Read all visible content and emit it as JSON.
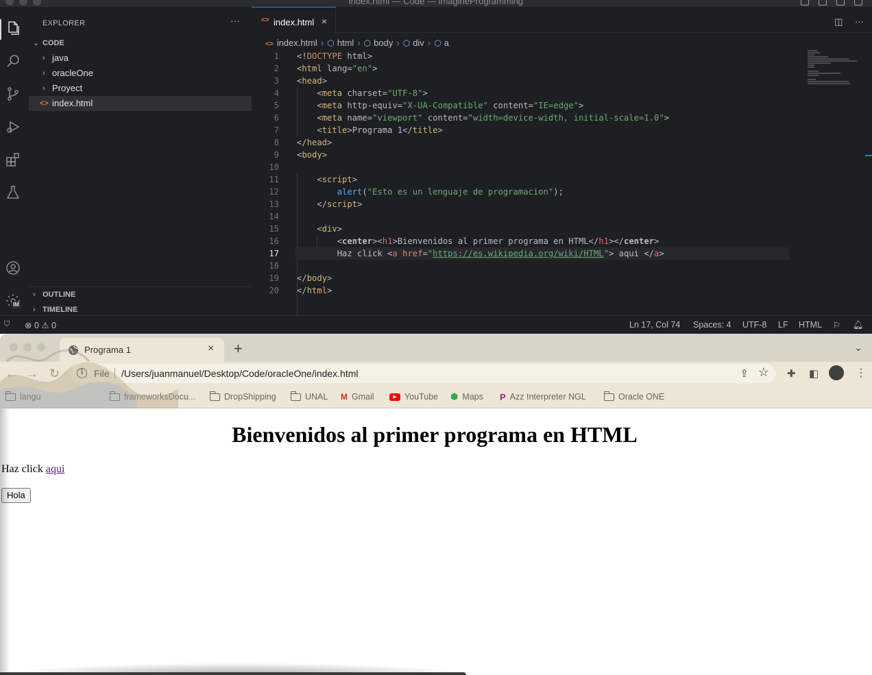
{
  "vscode": {
    "window_title": "index.html — Code — imagineProgramming",
    "explorer": {
      "header": "EXPLORER",
      "more": "···",
      "root_folder": "CODE",
      "items": [
        {
          "label": "java",
          "type": "folder"
        },
        {
          "label": "oracleOne",
          "type": "folder"
        },
        {
          "label": "Proyect",
          "type": "folder"
        },
        {
          "label": "index.html",
          "type": "file",
          "selected": true
        }
      ],
      "outline": "OUTLINE",
      "timeline": "TIMELINE"
    },
    "account_badge": "IM",
    "tab": {
      "label": "index.html",
      "close": "×"
    },
    "breadcrumbs": [
      "index.html",
      "html",
      "body",
      "div",
      "a"
    ],
    "code_lines": [
      "1",
      "2",
      "3",
      "4",
      "5",
      "6",
      "7",
      "8",
      "9",
      "10",
      "11",
      "12",
      "13",
      "14",
      "15",
      "16",
      "17",
      "18",
      "19",
      "20"
    ],
    "code": {
      "l1": [
        "<!",
        "DOCTYPE",
        " html",
        ">"
      ],
      "l2": [
        "<",
        "html",
        " lang",
        "=",
        "\"en\"",
        ">"
      ],
      "l3": [
        "<",
        "head",
        ">"
      ],
      "l4": [
        "<",
        "meta",
        " charset",
        "=",
        "\"UTF-8\"",
        ">"
      ],
      "l5": [
        "<",
        "meta",
        " http-equiv",
        "=",
        "\"X-UA-Compatible\"",
        " content",
        "=",
        "\"IE=edge\"",
        ">"
      ],
      "l6": [
        "<",
        "meta",
        " name",
        "=",
        "\"viewport\"",
        " content",
        "=",
        "\"width=device-width, initial-scale=1.0\"",
        ">"
      ],
      "l7": [
        "<",
        "title",
        ">",
        "Programa 1",
        "</",
        "title",
        ">"
      ],
      "l8": [
        "</",
        "head",
        ">"
      ],
      "l9": [
        "<",
        "body",
        ">"
      ],
      "l11": [
        "<",
        "script",
        ">"
      ],
      "l12": [
        "alert",
        "(",
        "\"Esto es un lenguaje de programacion\"",
        ");"
      ],
      "l13": [
        "</",
        "script",
        ">"
      ],
      "l15": [
        "<",
        "div",
        ">"
      ],
      "l16": [
        "<",
        "center",
        "><",
        "h1",
        ">",
        "Bienvenidos al primer programa en HTML",
        "</",
        "h1",
        "></",
        "center",
        ">"
      ],
      "l17": [
        "Haz click ",
        "<",
        "a",
        " href",
        "=",
        "\"",
        "https://es.wikipedia.org/wiki/HTML",
        "\"",
        "> aqui </",
        "a",
        ">"
      ],
      "l19": [
        "</",
        "body",
        ">"
      ],
      "l20": [
        "</",
        "html",
        ">"
      ]
    },
    "status": {
      "errors": "0",
      "warnings": "0",
      "position": "Ln 17, Col 74",
      "spaces": "Spaces: 4",
      "encoding": "UTF-8",
      "eol": "LF",
      "language": "HTML"
    }
  },
  "chrome": {
    "tab_title": "Programa 1",
    "tab_close": "×",
    "new_tab": "+",
    "omnibox": {
      "scheme": "File",
      "url": "/Users/juanmanuel/Desktop/Code/oracleOne/index.html"
    },
    "bookmarks": [
      {
        "label": "langu",
        "icon": "folder-icon"
      },
      {
        "label": "frameworksDocu...",
        "icon": "folder-icon"
      },
      {
        "label": "DropShipping",
        "icon": "folder-icon"
      },
      {
        "label": "UNAL",
        "icon": "folder-icon"
      },
      {
        "label": "Gmail",
        "icon": "gmail-icon"
      },
      {
        "label": "YouTube",
        "icon": "youtube-icon"
      },
      {
        "label": "Maps",
        "icon": "maps-icon"
      },
      {
        "label": "Azz Interpreter NGL",
        "icon": "app-icon"
      },
      {
        "label": "Oracle ONE",
        "icon": "folder-icon"
      }
    ],
    "page": {
      "heading": "Bienvenidos al primer programa en HTML",
      "text": "Haz click ",
      "link": "aqui",
      "button": "Hola"
    }
  }
}
